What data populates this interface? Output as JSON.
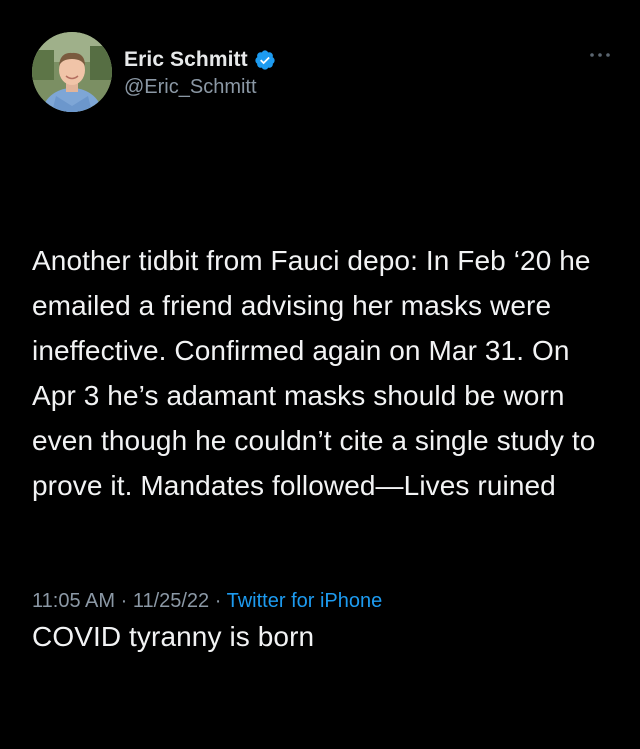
{
  "author": {
    "display_name": "Eric Schmitt",
    "handle": "@Eric_Schmitt",
    "verified": true,
    "verified_icon": "verified-badge-icon",
    "avatar_icon": "avatar-photo"
  },
  "tweet": {
    "paragraph_1": "Another tidbit from Fauci depo: In Feb ‘20 he emailed a friend advising her masks were ineffective. Confirmed again on Mar 31. On Apr 3 he’s adamant masks should be worn even though he couldn’t cite a single study to prove it. Mandates followed—Lives ruined",
    "paragraph_2": "COVID tyranny is born"
  },
  "meta": {
    "time": "11:05 AM",
    "separator_1": " · ",
    "date": "11/25/22",
    "separator_2": " · ",
    "source": "Twitter for iPhone"
  },
  "colors": {
    "background": "#000000",
    "text": "#e7e9ea",
    "secondary": "#8b98a5",
    "accent": "#1d9bf0"
  },
  "more_icon": "more-dots-icon"
}
